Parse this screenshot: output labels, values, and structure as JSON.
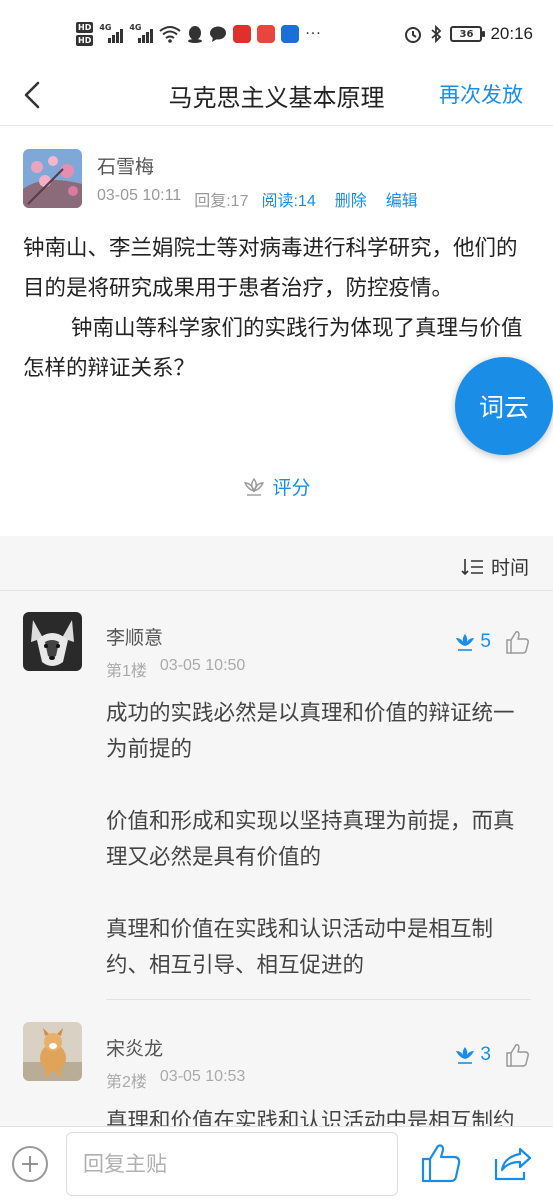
{
  "status_bar": {
    "hd1": "HD",
    "hd2": "HD",
    "net1": "4G",
    "net2": "4G",
    "more": "···",
    "battery": "36",
    "time": "20:16"
  },
  "header": {
    "back_icon": "chevron-left-icon",
    "title": "马克思主义基本原理",
    "action": "再次发放"
  },
  "post": {
    "author": "石雪梅",
    "date": "03-05 10:11",
    "replies": "回复:17",
    "reads": "阅读:14",
    "delete": "删除",
    "edit": "编辑",
    "paragraph1": "钟南山、李兰娟院士等对病毒进行科学研究，他们的目的是将研究成果用于患者治疗，防控疫情。",
    "paragraph2": "钟南山等科学家们的实践行为体现了真理与价值怎样的辩证关系？",
    "rate_label": "评分"
  },
  "word_cloud_button": "词云",
  "sort": {
    "label": "时间"
  },
  "replies": [
    {
      "name": "李顺意",
      "floor": "第1楼",
      "date": "03-05 10:50",
      "flowers": "5",
      "paragraphs": [
        "成功的实践必然是以真理和价值的辩证统一为前提的",
        "价值和形成和实现以坚持真理为前提，而真理又必然是具有价值的",
        "真理和价值在实践和认识活动中是相互制约、相互引导、相互促进的"
      ]
    },
    {
      "name": "宋炎龙",
      "floor": "第2楼",
      "date": "03-05 10:53",
      "flowers": "3",
      "paragraphs": [
        "真理和价值在实践和认识活动中是相互制约"
      ]
    }
  ],
  "bottom_bar": {
    "reply_placeholder": "回复主贴"
  },
  "colors": {
    "accent": "#1a8ee6",
    "comments_bg": "#f6f6f6"
  }
}
